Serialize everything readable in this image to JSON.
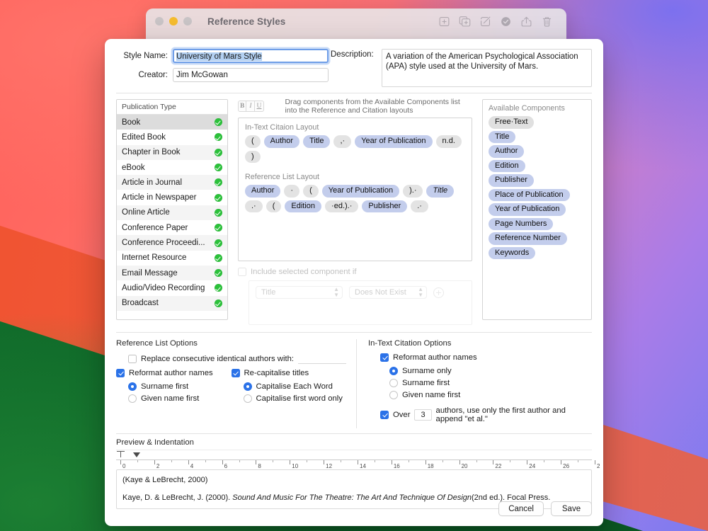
{
  "background_window": {
    "title": "Reference Styles",
    "traffic_lights": [
      "close-inactive",
      "minimize-yellow",
      "zoom-inactive"
    ],
    "toolbar_icons": [
      "add-icon",
      "duplicate-icon",
      "edit-icon",
      "validate-icon",
      "share-icon",
      "delete-icon"
    ]
  },
  "header": {
    "style_name_label": "Style Name:",
    "style_name_value": "University of Mars Style",
    "creator_label": "Creator:",
    "creator_value": "Jim McGowan",
    "description_label": "Description:",
    "description_value": "A variation of the American Psychological Association (APA) style used at the University of Mars."
  },
  "publication_type": {
    "header": "Publication Type",
    "items": [
      {
        "label": "Book",
        "selected": true,
        "enabled": true
      },
      {
        "label": "Edited Book",
        "selected": false,
        "enabled": true
      },
      {
        "label": "Chapter in Book",
        "selected": false,
        "enabled": true
      },
      {
        "label": "eBook",
        "selected": false,
        "enabled": true
      },
      {
        "label": "Article in Journal",
        "selected": false,
        "enabled": true
      },
      {
        "label": "Article in Newspaper",
        "selected": false,
        "enabled": true
      },
      {
        "label": "Online Article",
        "selected": false,
        "enabled": true
      },
      {
        "label": "Conference Paper",
        "selected": false,
        "enabled": true
      },
      {
        "label": "Conference Proceedi...",
        "selected": false,
        "enabled": true
      },
      {
        "label": "Internet Resource",
        "selected": false,
        "enabled": true
      },
      {
        "label": "Email Message",
        "selected": false,
        "enabled": true
      },
      {
        "label": "Audio/Video Recording",
        "selected": false,
        "enabled": true
      },
      {
        "label": "Broadcast",
        "selected": false,
        "enabled": true
      }
    ]
  },
  "format_bar": {
    "bold": "B",
    "italic": "I",
    "underline": "U",
    "hint": "Drag components from the Available Components list into the Reference and Citation layouts"
  },
  "in_text_citation_layout": {
    "title": "In-Text Citaion Layout",
    "tokens": [
      {
        "text": "(",
        "kind": "literal"
      },
      {
        "text": "Author",
        "kind": "component"
      },
      {
        "text": "Title",
        "kind": "component"
      },
      {
        "text": ",·",
        "kind": "literal"
      },
      {
        "text": "Year of Publication",
        "kind": "component"
      },
      {
        "text": "n.d.",
        "kind": "literal"
      },
      {
        "text": ")",
        "kind": "literal"
      }
    ]
  },
  "reference_list_layout": {
    "title": "Reference List Layout",
    "tokens": [
      {
        "text": "Author",
        "kind": "component"
      },
      {
        "text": "·",
        "kind": "literal"
      },
      {
        "text": "(",
        "kind": "literal"
      },
      {
        "text": "Year of Publication",
        "kind": "component"
      },
      {
        "text": ").·",
        "kind": "literal"
      },
      {
        "text": "Title",
        "kind": "component",
        "italic": true
      },
      {
        "text": ".·",
        "kind": "literal"
      },
      {
        "text": "(",
        "kind": "literal"
      },
      {
        "text": "Edition",
        "kind": "component"
      },
      {
        "text": "·ed.).·",
        "kind": "literal"
      },
      {
        "text": "Publisher",
        "kind": "component"
      },
      {
        "text": ".·",
        "kind": "literal"
      }
    ]
  },
  "include_if": {
    "checkbox_label": "Include selected component if",
    "checked": false,
    "enabled": false,
    "component_select": "Title",
    "condition_select": "Does Not Exist",
    "add_button": "+"
  },
  "available_components": {
    "header": "Available Components",
    "items": [
      {
        "label": "Free·Text",
        "kind": "literal"
      },
      {
        "label": "Title",
        "kind": "component"
      },
      {
        "label": "Author",
        "kind": "component"
      },
      {
        "label": "Edition",
        "kind": "component"
      },
      {
        "label": "Publisher",
        "kind": "component"
      },
      {
        "label": "Place of Publication",
        "kind": "component"
      },
      {
        "label": "Year of Publication",
        "kind": "component"
      },
      {
        "label": "Page Numbers",
        "kind": "component"
      },
      {
        "label": "Reference Number",
        "kind": "component"
      },
      {
        "label": "Keywords",
        "kind": "component"
      }
    ]
  },
  "reference_list_options": {
    "title": "Reference List Options",
    "replace_authors_label": "Replace consecutive identical authors with:",
    "replace_authors_checked": false,
    "replace_authors_value": "",
    "reformat_label": "Reformat author names",
    "reformat_checked": true,
    "reformat_radios": [
      {
        "label": "Surname first",
        "selected": true
      },
      {
        "label": "Given name first",
        "selected": false
      }
    ],
    "recapitalise_label": "Re-capitalise titles",
    "recapitalise_checked": true,
    "recapitalise_radios": [
      {
        "label": "Capitalise Each Word",
        "selected": true
      },
      {
        "label": "Capitalise first word only",
        "selected": false
      }
    ]
  },
  "in_text_citation_options": {
    "title": "In-Text Citation Options",
    "reformat_label": "Reformat author names",
    "reformat_checked": true,
    "reformat_radios": [
      {
        "label": "Surname only",
        "selected": true
      },
      {
        "label": "Surname first",
        "selected": false
      },
      {
        "label": "Given name first",
        "selected": false
      }
    ],
    "et_al_checked": true,
    "et_al_prefix": "Over",
    "et_al_count": "3",
    "et_al_suffix": "authors, use only the first author and append \"et al.\""
  },
  "preview": {
    "title": "Preview & Indentation",
    "ruler": {
      "unit_min": 0,
      "unit_max": 28,
      "labels": [
        "0",
        "2",
        "4",
        "6",
        "8",
        "10",
        "12",
        "14",
        "16",
        "18",
        "20",
        "22",
        "24",
        "26",
        "2"
      ],
      "first_line_indent": 0,
      "left_indent": 1
    },
    "line1": "(Kaye & LeBrecht, 2000)",
    "line2_part1": "Kaye, D. & LeBrecht, J. (2000). ",
    "line2_italic": "Sound And Music For The Theatre: The Art And Technique Of Design",
    "line2_part2": "(2nd ed.). Focal Press."
  },
  "footer": {
    "cancel_label": "Cancel",
    "save_label": "Save"
  },
  "colors": {
    "accent_blue": "#2b72e8",
    "component_token": "#c3cdec",
    "literal_token": "#e3e3e3",
    "check_green": "#2cc13b",
    "selected_row": "#dcdcdc"
  }
}
